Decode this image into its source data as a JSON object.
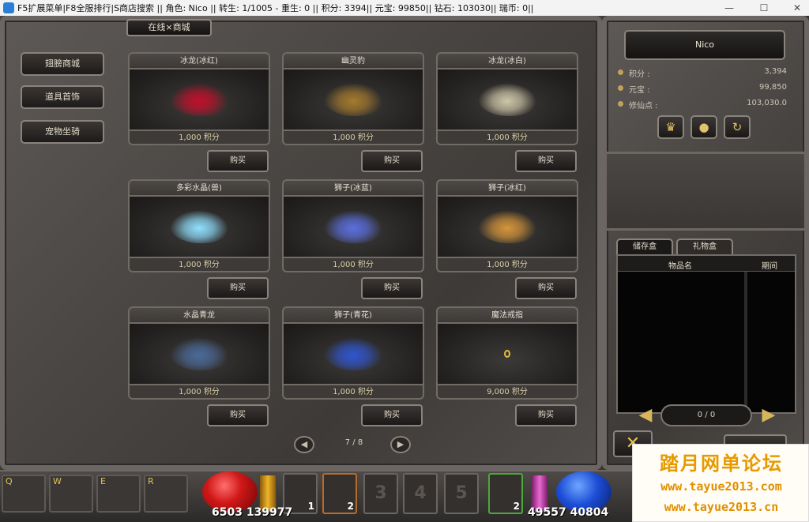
{
  "window": {
    "title": "F5扩展菜单|F8全服排行|S商店搜索 || 角色: Nico || 转生: 1/1005 - 重生: 0 || 积分: 3394|| 元宝: 99850|| 钻石: 103030|| 瑞币: 0||",
    "minimize": "—",
    "maximize": "☐",
    "close": "✕"
  },
  "shop": {
    "title": "在线×商城",
    "sidebar": [
      "翅膀商城",
      "道具首饰",
      "宠物坐骑"
    ],
    "buy_label": "购买",
    "items": [
      {
        "name": "冰龙(冰红)",
        "price": "1,000 积分",
        "color": "#c0102a"
      },
      {
        "name": "幽灵豹",
        "price": "1,000 积分",
        "color": "#a57a2c"
      },
      {
        "name": "冰龙(冰白)",
        "price": "1,000 积分",
        "color": "#cfc6a8"
      },
      {
        "name": "多彩水晶(兽)",
        "price": "1,000 积分",
        "color": "#8fe0ff"
      },
      {
        "name": "狮子(冰蓝)",
        "price": "1,000 积分",
        "color": "#5a6fe0"
      },
      {
        "name": "狮子(冰红)",
        "price": "1,000 积分",
        "color": "#d6953a"
      },
      {
        "name": "水晶青龙",
        "price": "1,000 积分",
        "color": "#4b6a9a"
      },
      {
        "name": "狮子(青花)",
        "price": "1,000 积分",
        "color": "#2f55d0"
      },
      {
        "name": "魔法戒指",
        "price": "9,000 积分",
        "color": "#e3c23a"
      }
    ],
    "page": "7 / 8"
  },
  "player": {
    "name": "Nico",
    "stats": [
      {
        "label": "积分 :",
        "value": "3,394"
      },
      {
        "label": "元宝 :",
        "value": "99,850"
      },
      {
        "label": "修仙点 :",
        "value": "103,030.0"
      }
    ],
    "icons": [
      "crown-icon",
      "coins-icon",
      "refresh-icon"
    ]
  },
  "inventory": {
    "tabs": [
      "储存盒",
      "礼物盒"
    ],
    "columns": [
      "物品名",
      "期间"
    ],
    "page": "0 / 0"
  },
  "hotbar": {
    "keys": [
      "Q",
      "W",
      "E",
      "R"
    ],
    "skills": [
      {
        "num": "",
        "count": "1"
      },
      {
        "num": "",
        "count": "2"
      },
      {
        "num": "3",
        "count": ""
      },
      {
        "num": "4",
        "count": ""
      },
      {
        "num": "5",
        "count": ""
      },
      {
        "num": "",
        "count": "2"
      }
    ],
    "hp": "6503 139977",
    "mp": "49557 40804"
  },
  "watermark": {
    "title": "踏月网单论坛",
    "url1": "www.tayue2013.com",
    "url2": "www.tayue2013.cn"
  }
}
